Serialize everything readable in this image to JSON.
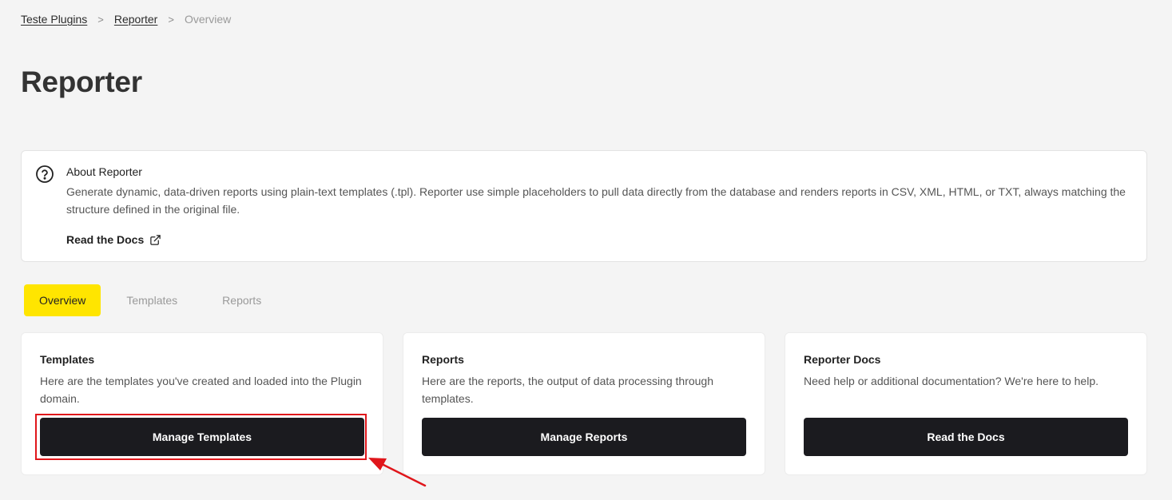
{
  "breadcrumb": {
    "items": [
      "Teste Plugins",
      "Reporter"
    ],
    "current": "Overview",
    "separator": ">"
  },
  "page": {
    "title": "Reporter"
  },
  "about": {
    "title": "About Reporter",
    "description": "Generate dynamic, data-driven reports using plain-text templates (.tpl). Reporter use simple placeholders to pull data directly from the database and renders reports in CSV, XML, HTML, or TXT, always matching the structure defined in the original file.",
    "link_label": "Read the Docs",
    "icon": "question-circle-icon",
    "link_icon": "external-link-icon"
  },
  "tabs": [
    {
      "label": "Overview",
      "active": true
    },
    {
      "label": "Templates",
      "active": false
    },
    {
      "label": "Reports",
      "active": false
    }
  ],
  "cards": [
    {
      "title": "Templates",
      "description": "Here are the templates you've created and loaded into the Plugin domain.",
      "button": "Manage Templates"
    },
    {
      "title": "Reports",
      "description": "Here are the reports, the output of data processing through templates.",
      "button": "Manage Reports"
    },
    {
      "title": "Reporter Docs",
      "description": "Need help or additional documentation? We're here to help.",
      "button": "Read the Docs"
    }
  ],
  "colors": {
    "accent": "#ffe500",
    "button": "#1b1b1f",
    "annotation": "#e0161b"
  }
}
